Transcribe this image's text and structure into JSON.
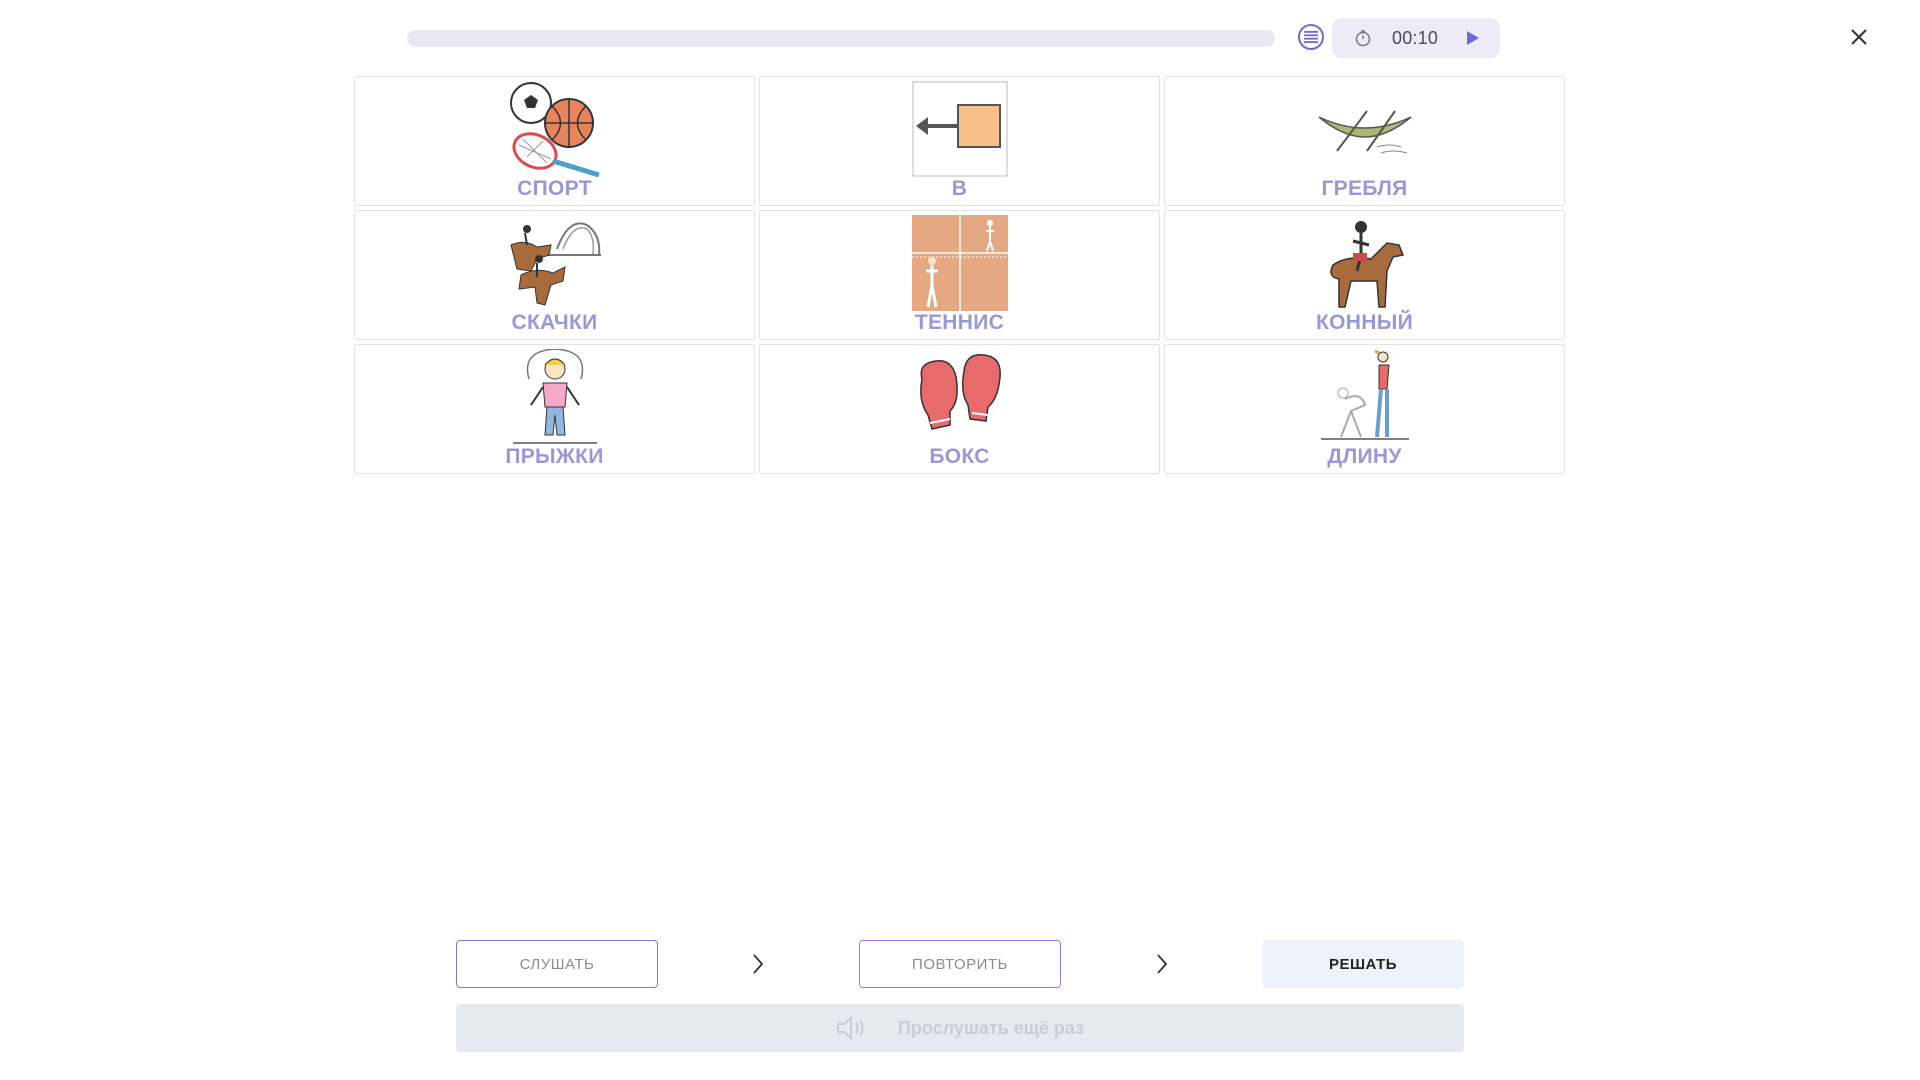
{
  "timer": {
    "value": "00:10"
  },
  "progress": {
    "fraction": 0
  },
  "cards": [
    {
      "word": "СПОРТ",
      "icon": "sports-balls-icon"
    },
    {
      "word": "В",
      "icon": "arrow-into-box-icon"
    },
    {
      "word": "ГРЕБЛЯ",
      "icon": "rowing-boat-icon"
    },
    {
      "word": "СКАЧКИ",
      "icon": "horse-racing-icon"
    },
    {
      "word": "ТЕННИС",
      "icon": "tennis-court-icon"
    },
    {
      "word": "КОННЫЙ",
      "icon": "horse-rider-icon"
    },
    {
      "word": "ПРЫЖКИ",
      "icon": "jump-rope-girl-icon"
    },
    {
      "word": "БОКС",
      "icon": "boxing-gloves-icon"
    },
    {
      "word": "ДЛИНУ",
      "icon": "long-jump-icon"
    }
  ],
  "controls": {
    "listen_label": "СЛУШАТЬ",
    "repeat_label": "ПОВТОРИТЬ",
    "solve_label": "РЕШАТЬ",
    "listen_again_label": "Прослушать ещё раз"
  },
  "colors": {
    "accent": "#6f6bd0",
    "word": "#9a97d8"
  }
}
